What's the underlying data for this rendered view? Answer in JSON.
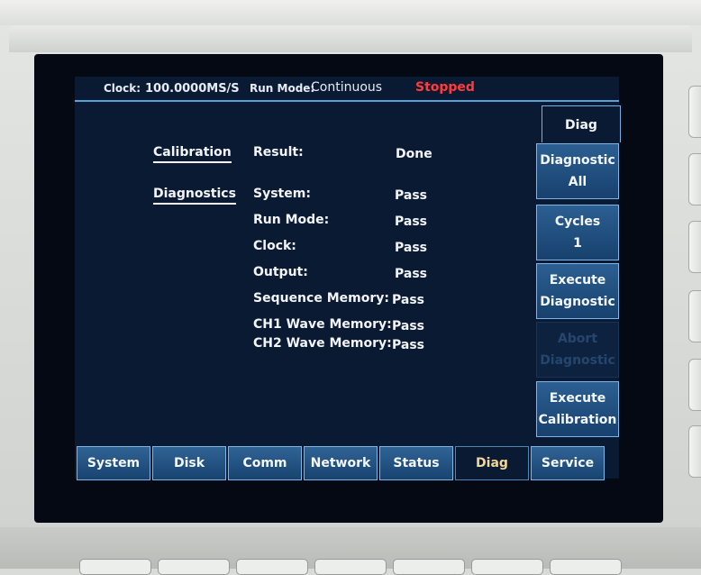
{
  "status_bar": {
    "clock_label": "Clock:",
    "clock_value": "100.0000MS/S",
    "run_mode_label": "Run Mode:",
    "run_mode_value": "Continuous",
    "run_state": "Stopped"
  },
  "main": {
    "calibration_header": "Calibration",
    "calibration_result_label": "Result:",
    "calibration_result_value": "Done",
    "diagnostics_header": "Diagnostics",
    "diagnostics": [
      {
        "label": "System:",
        "value": "Pass"
      },
      {
        "label": "Run Mode:",
        "value": "Pass"
      },
      {
        "label": "Clock:",
        "value": "Pass"
      },
      {
        "label": "Output:",
        "value": "Pass"
      },
      {
        "label": "Sequence Memory:",
        "value": "Pass"
      },
      {
        "label": "CH1 Wave Memory:",
        "value": "Pass"
      },
      {
        "label": "CH2 Wave Memory:",
        "value": "Pass"
      }
    ]
  },
  "side_menu": {
    "title": "Diag",
    "buttons": [
      {
        "line1": "Diagnostic",
        "line2": "All",
        "enabled": true
      },
      {
        "line1": "Cycles",
        "line2": "1",
        "enabled": true
      },
      {
        "line1": "Execute",
        "line2": "Diagnostic",
        "enabled": true
      },
      {
        "line1": "Abort",
        "line2": "Diagnostic",
        "enabled": false
      },
      {
        "line1": "Execute",
        "line2": "Calibration",
        "enabled": true
      }
    ]
  },
  "tabs": [
    {
      "label": "System",
      "active": false
    },
    {
      "label": "Disk",
      "active": false
    },
    {
      "label": "Comm",
      "active": false
    },
    {
      "label": "Network",
      "active": false
    },
    {
      "label": "Status",
      "active": false
    },
    {
      "label": "Diag",
      "active": true
    },
    {
      "label": "Service",
      "active": false
    }
  ],
  "colors": {
    "screen_bg": "#0b1a33",
    "button_blue": "#2c5f92",
    "stopped_red": "#ff3b3b",
    "active_tab_text": "#f2d79c"
  }
}
